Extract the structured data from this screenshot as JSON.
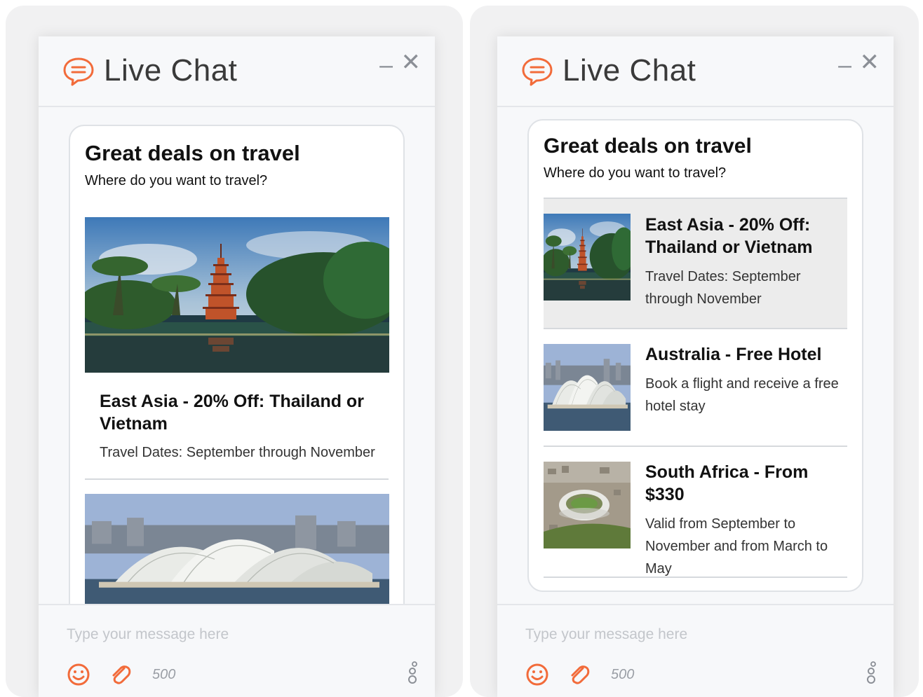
{
  "panels": [
    {
      "header": {
        "title": "Live Chat",
        "minimize_label": "–",
        "close_label": "✕"
      },
      "card": {
        "title": "Great deals on travel",
        "subtitle": "Where do you want to travel?",
        "items": [
          {
            "title": "East Asia - 20% Off: Thailand or Vietnam",
            "description": "Travel Dates: September through November",
            "image_icon": "pagoda-photo"
          },
          {
            "image_icon": "opera-house-photo"
          }
        ]
      },
      "footer": {
        "placeholder": "Type your message here",
        "char_count": "500"
      }
    },
    {
      "header": {
        "title": "Live Chat",
        "minimize_label": "–",
        "close_label": "✕"
      },
      "card": {
        "title": "Great deals on travel",
        "subtitle": "Where do you want to travel?",
        "items": [
          {
            "title": "East Asia - 20% Off: Thailand or Vietnam",
            "description": "Travel Dates: September through November",
            "image_icon": "pagoda-photo",
            "highlighted": true
          },
          {
            "title": "Australia - Free Hotel",
            "description": "Book a flight and receive a free hotel stay",
            "image_icon": "opera-house-photo"
          },
          {
            "title": "South Africa - From $330",
            "description": "Valid from September to November and from March to May",
            "image_icon": "stadium-photo"
          }
        ]
      },
      "footer": {
        "placeholder": "Type your message here",
        "char_count": "500"
      }
    }
  ],
  "colors": {
    "accent": "#f26b3a",
    "divider": "#d6d9dd",
    "highlight": "#ececec"
  }
}
